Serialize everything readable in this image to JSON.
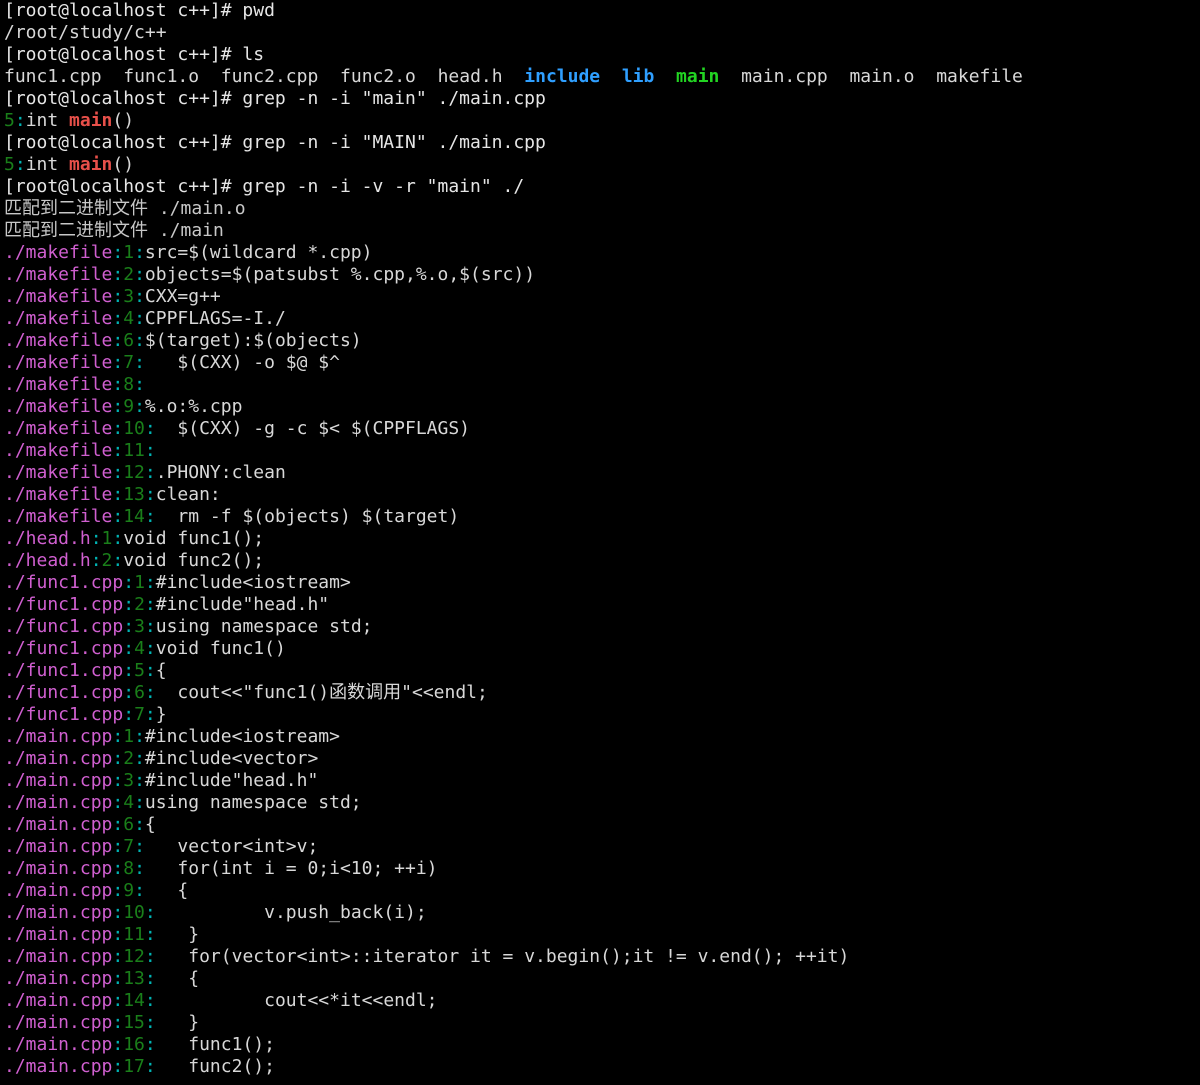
{
  "terminal": {
    "title": "root@localhost:~/study/c++",
    "background": "#000000",
    "foreground": "#d8d8d8",
    "prompt": "[root@localhost c++]# ",
    "colors": {
      "default": "#d8d8d8",
      "directory": "#2f9fff",
      "executable": "#22d422",
      "filename": "#d05fd0",
      "line_number": "#1a7f1a",
      "separator": "#00b4b4",
      "match": "#e8504a"
    },
    "lines": [
      {
        "id": "l0",
        "type": "prompt",
        "prompt": "[root@localhost c++]# ",
        "command": "pwd"
      },
      {
        "id": "l1",
        "type": "output",
        "text": "/root/study/c++"
      },
      {
        "id": "l2",
        "type": "prompt",
        "prompt": "[root@localhost c++]# ",
        "command": "ls"
      },
      {
        "id": "l3",
        "type": "ls",
        "entries": [
          {
            "name": "func1.cpp",
            "kind": "file"
          },
          {
            "name": "func1.o",
            "kind": "file"
          },
          {
            "name": "func2.cpp",
            "kind": "file"
          },
          {
            "name": "func2.o",
            "kind": "file"
          },
          {
            "name": "head.h",
            "kind": "file"
          },
          {
            "name": "include",
            "kind": "directory"
          },
          {
            "name": "lib",
            "kind": "directory"
          },
          {
            "name": "main",
            "kind": "executable"
          },
          {
            "name": "main.cpp",
            "kind": "file"
          },
          {
            "name": "main.o",
            "kind": "file"
          },
          {
            "name": "makefile",
            "kind": "file"
          }
        ]
      },
      {
        "id": "l4",
        "type": "prompt",
        "prompt": "[root@localhost c++]# ",
        "command": "grep -n -i \"main\" ./main.cpp"
      },
      {
        "id": "l5",
        "type": "grep",
        "file": "",
        "lineno": "5",
        "before": "int ",
        "match": "main",
        "after": "()"
      },
      {
        "id": "l6",
        "type": "prompt",
        "prompt": "[root@localhost c++]# ",
        "command": "grep -n -i \"MAIN\" ./main.cpp"
      },
      {
        "id": "l7",
        "type": "grep",
        "file": "",
        "lineno": "5",
        "before": "int ",
        "match": "main",
        "after": "()"
      },
      {
        "id": "l8",
        "type": "prompt",
        "prompt": "[root@localhost c++]# ",
        "command": "grep -n -i -v -r \"main\" ./"
      },
      {
        "id": "l9",
        "type": "binary",
        "text": "匹配到二进制文件 ./main.o"
      },
      {
        "id": "l10",
        "type": "binary",
        "text": "匹配到二进制文件 ./main"
      },
      {
        "id": "l11",
        "type": "grep",
        "file": "./makefile",
        "lineno": "1",
        "text": "src=$(wildcard *.cpp)"
      },
      {
        "id": "l12",
        "type": "grep",
        "file": "./makefile",
        "lineno": "2",
        "text": "objects=$(patsubst %.cpp,%.o,$(src))"
      },
      {
        "id": "l13",
        "type": "grep",
        "file": "./makefile",
        "lineno": "3",
        "text": "CXX=g++"
      },
      {
        "id": "l14",
        "type": "grep",
        "file": "./makefile",
        "lineno": "4",
        "text": "CPPFLAGS=-I./"
      },
      {
        "id": "l15",
        "type": "grep",
        "file": "./makefile",
        "lineno": "6",
        "text": "$(target):$(objects)"
      },
      {
        "id": "l16",
        "type": "grep",
        "file": "./makefile",
        "lineno": "7",
        "text": "   $(CXX) -o $@ $^"
      },
      {
        "id": "l17",
        "type": "grep",
        "file": "./makefile",
        "lineno": "8",
        "text": ""
      },
      {
        "id": "l18",
        "type": "grep",
        "file": "./makefile",
        "lineno": "9",
        "text": "%.o:%.cpp"
      },
      {
        "id": "l19",
        "type": "grep",
        "file": "./makefile",
        "lineno": "10",
        "text": "  $(CXX) -g -c $< $(CPPFLAGS)"
      },
      {
        "id": "l20",
        "type": "grep",
        "file": "./makefile",
        "lineno": "11",
        "text": ""
      },
      {
        "id": "l21",
        "type": "grep",
        "file": "./makefile",
        "lineno": "12",
        "text": ".PHONY:clean"
      },
      {
        "id": "l22",
        "type": "grep",
        "file": "./makefile",
        "lineno": "13",
        "text": "clean:"
      },
      {
        "id": "l23",
        "type": "grep",
        "file": "./makefile",
        "lineno": "14",
        "text": "  rm -f $(objects) $(target)"
      },
      {
        "id": "l24",
        "type": "grep",
        "file": "./head.h",
        "lineno": "1",
        "text": "void func1();"
      },
      {
        "id": "l25",
        "type": "grep",
        "file": "./head.h",
        "lineno": "2",
        "text": "void func2();"
      },
      {
        "id": "l26",
        "type": "grep",
        "file": "./func1.cpp",
        "lineno": "1",
        "text": "#include<iostream>"
      },
      {
        "id": "l27",
        "type": "grep",
        "file": "./func1.cpp",
        "lineno": "2",
        "text": "#include\"head.h\""
      },
      {
        "id": "l28",
        "type": "grep",
        "file": "./func1.cpp",
        "lineno": "3",
        "text": "using namespace std;"
      },
      {
        "id": "l29",
        "type": "grep",
        "file": "./func1.cpp",
        "lineno": "4",
        "text": "void func1()"
      },
      {
        "id": "l30",
        "type": "grep",
        "file": "./func1.cpp",
        "lineno": "5",
        "text": "{"
      },
      {
        "id": "l31",
        "type": "grep",
        "file": "./func1.cpp",
        "lineno": "6",
        "text": "  cout<<\"func1()函数调用\"<<endl;"
      },
      {
        "id": "l32",
        "type": "grep",
        "file": "./func1.cpp",
        "lineno": "7",
        "text": "}"
      },
      {
        "id": "l33",
        "type": "grep",
        "file": "./main.cpp",
        "lineno": "1",
        "text": "#include<iostream>"
      },
      {
        "id": "l34",
        "type": "grep",
        "file": "./main.cpp",
        "lineno": "2",
        "text": "#include<vector>"
      },
      {
        "id": "l35",
        "type": "grep",
        "file": "./main.cpp",
        "lineno": "3",
        "text": "#include\"head.h\""
      },
      {
        "id": "l36",
        "type": "grep",
        "file": "./main.cpp",
        "lineno": "4",
        "text": "using namespace std;"
      },
      {
        "id": "l37",
        "type": "grep",
        "file": "./main.cpp",
        "lineno": "6",
        "text": "{"
      },
      {
        "id": "l38",
        "type": "grep",
        "file": "./main.cpp",
        "lineno": "7",
        "text": "   vector<int>v;"
      },
      {
        "id": "l39",
        "type": "grep",
        "file": "./main.cpp",
        "lineno": "8",
        "text": "   for(int i = 0;i<10; ++i)"
      },
      {
        "id": "l40",
        "type": "grep",
        "file": "./main.cpp",
        "lineno": "9",
        "text": "   {"
      },
      {
        "id": "l41",
        "type": "grep",
        "file": "./main.cpp",
        "lineno": "10",
        "text": "          v.push_back(i);"
      },
      {
        "id": "l42",
        "type": "grep",
        "file": "./main.cpp",
        "lineno": "11",
        "text": "   }"
      },
      {
        "id": "l43",
        "type": "grep",
        "file": "./main.cpp",
        "lineno": "12",
        "text": "   for(vector<int>::iterator it = v.begin();it != v.end(); ++it)"
      },
      {
        "id": "l44",
        "type": "grep",
        "file": "./main.cpp",
        "lineno": "13",
        "text": "   {"
      },
      {
        "id": "l45",
        "type": "grep",
        "file": "./main.cpp",
        "lineno": "14",
        "text": "          cout<<*it<<endl;"
      },
      {
        "id": "l46",
        "type": "grep",
        "file": "./main.cpp",
        "lineno": "15",
        "text": "   }"
      },
      {
        "id": "l47",
        "type": "grep",
        "file": "./main.cpp",
        "lineno": "16",
        "text": "   func1();"
      },
      {
        "id": "l48",
        "type": "grep",
        "file": "./main.cpp",
        "lineno": "17",
        "text": "   func2();"
      }
    ]
  }
}
